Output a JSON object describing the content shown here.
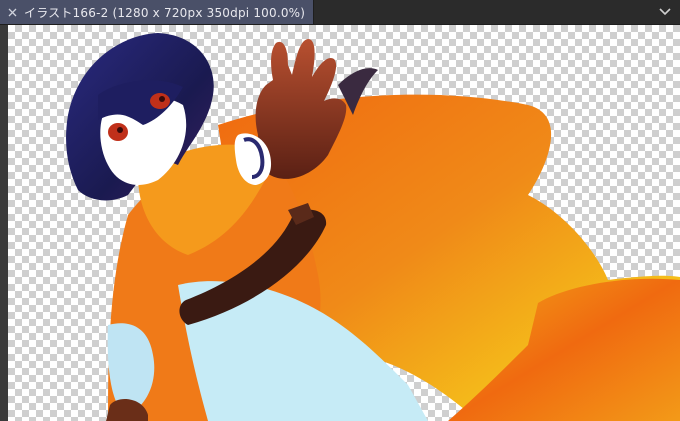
{
  "document_tab": {
    "title": "イラスト166-2 (1280 x 720px 350dpi 100.0%)"
  },
  "icons": {
    "close": "close-icon",
    "menu": "chevron-down-icon"
  },
  "colors": {
    "tab_bg": "#4a5068",
    "titlebar_bg": "#2b2b2b",
    "scarf_orange": "#f07a18",
    "scarf_yellow": "#f5d21a",
    "hair_navy": "#1c1c5e",
    "skin_brown": "#6a2a18",
    "shirt_blue": "#bfe9f5"
  }
}
